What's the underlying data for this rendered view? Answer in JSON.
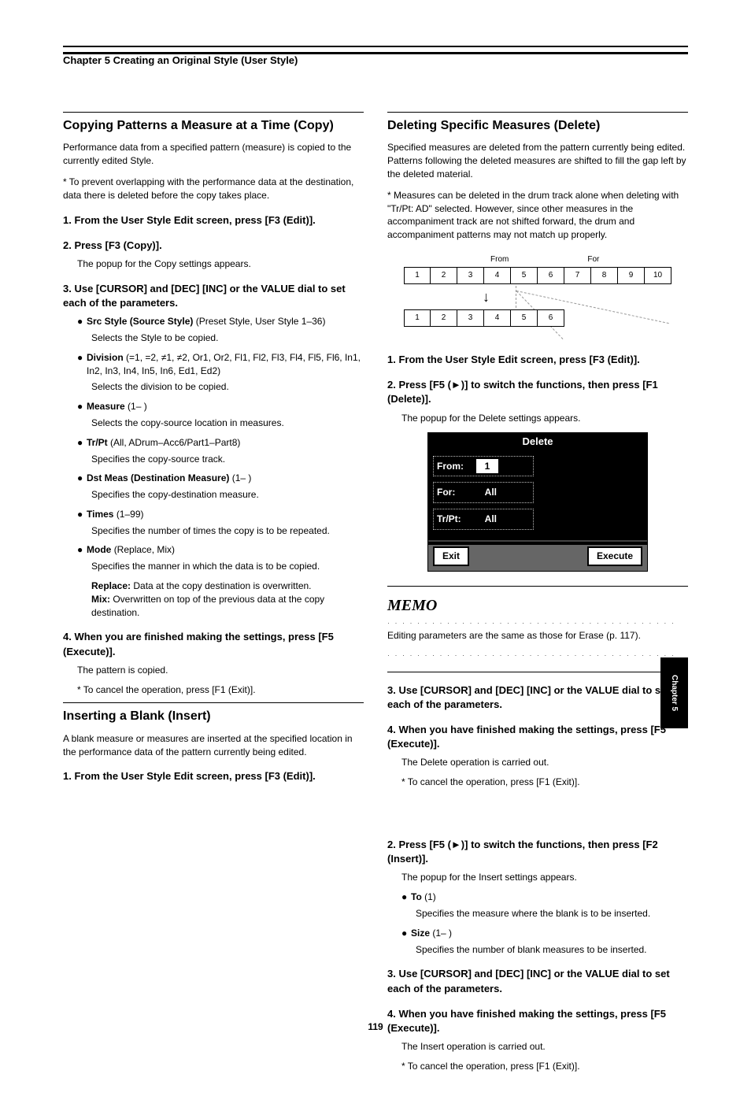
{
  "header": "Chapter 5 Creating an Original Style (User Style)",
  "left": {
    "sec1": {
      "title": "Copying Patterns a Measure at a Time (Copy)",
      "p1": "Performance data from a specified pattern (measure) is copied to the currently edited Style.",
      "p2": "* To prevent overlapping with the performance data at the destination, data there is deleted before the copy takes place.",
      "s1_title": "1. From the User Style Edit screen, press [F3 (Edit)].",
      "s2_title": "2. Press [F3 (Copy)].",
      "s2_note": "The popup for the Copy settings appears.",
      "s3_title": "3. Use [CURSOR] and [DEC] [INC] or the VALUE dial to set each of the parameters.",
      "items": [
        {
          "b": "●",
          "label": "Src Style (Source Style)",
          "text": "(Preset Style, User Style 1–36)",
          "desc": "Selects the Style to be copied."
        },
        {
          "b": "●",
          "label": "Division",
          "text": "(=1, =2, ≠1, ≠2, Or1, Or2, Fl1, Fl2, Fl3, Fl4, Fl5, Fl6, In1, In2, In3, In4, In5, In6, Ed1, Ed2)",
          "desc": "Selects the division to be copied."
        },
        {
          "b": "●",
          "label": "Measure",
          "text": "(1– )",
          "desc": "Selects the copy-source location in measures."
        },
        {
          "b": "●",
          "label": "Tr/Pt",
          "text": "(All, ADrum–Acc6/Part1–Part8)",
          "desc": "Specifies the copy-source track."
        },
        {
          "b": "●",
          "label": "Dst Meas (Destination Measure)",
          "text": "(1– )",
          "desc": "Specifies the copy-destination measure."
        },
        {
          "b": "●",
          "label": "Times",
          "text": "(1–99)",
          "desc": "Specifies the number of times the copy is to be repeated."
        },
        {
          "b": "●",
          "label": "Mode",
          "text": "(Replace, Mix)",
          "desc": "Specifies the manner in which the data is to be copied.",
          "sub": [
            {
              "k": "Replace:",
              "v": "Data at the copy destination is overwritten."
            },
            {
              "k": "Mix:",
              "v": "Overwritten on top of the previous data at the copy destination."
            }
          ]
        }
      ],
      "s4_title": "4. When you are finished making the settings, press [F5 (Execute)].",
      "s4_note1": "The pattern is copied.",
      "s4_note2": "* To cancel the operation, press [F1 (Exit)]."
    },
    "sec2": {
      "title": "Inserting a Blank (Insert)",
      "p1": "A blank measure or measures are inserted at the specified location in the performance data of the pattern currently being edited.",
      "s1_title": "1. From the User Style Edit screen, press [F3 (Edit)]."
    }
  },
  "right": {
    "delete_section": {
      "title": "Deleting Specific Measures (Delete)",
      "p1": "Specified measures are deleted from the pattern currently being edited. Patterns following the deleted measures are shifted to fill the gap left by the deleted material.",
      "p2": "* Measures can be deleted in the drum track alone when deleting with \"Tr/Pt: AD\" selected. However, since other measures in the accompaniment track are not shifted forward, the drum and accompaniment patterns may not match up properly.",
      "diagram": {
        "from_label": "From",
        "for_label": "For",
        "row1": [
          "1",
          "2",
          "3",
          "4",
          "5",
          "6",
          "7",
          "8",
          "9",
          "10"
        ],
        "row2": [
          "1",
          "2",
          "3",
          "4",
          "5",
          "6"
        ]
      },
      "s1": "1. From the User Style Edit screen, press [F3 (Edit)].",
      "s2": "2. Press [F5 (►)] to switch the functions, then press [F1 (Delete)].",
      "s2_note": "The popup for the Delete settings appears.",
      "dialog": {
        "title": "Delete",
        "from_label": "From:",
        "from_val": "1",
        "for_label": "For:",
        "for_val": "All",
        "trpt_label": "Tr/Pt:",
        "trpt_val": "All",
        "exit": "Exit",
        "execute": "Execute"
      },
      "memo_title": "MEMO",
      "memo_text": "Editing parameters are the same as those for Erase (p. 117).",
      "s3": "3. Use [CURSOR] and [DEC] [INC] or the VALUE dial to set each of the parameters.",
      "s4": "4. When you have finished making the settings, press [F5 (Execute)].",
      "s4_note1": "The Delete operation is carried out.",
      "s4_note2": "* To cancel the operation, press [F1 (Exit)]."
    },
    "insert_cont": {
      "s2": "2. Press [F5 (►)] to switch the functions, then press [F2 (Insert)].",
      "s2_note": "The popup for the Insert settings appears.",
      "items": [
        {
          "b": "●",
          "label": "To",
          "text": "(1)",
          "desc": "Specifies the measure where the blank is to be inserted."
        },
        {
          "b": "●",
          "label": "Size",
          "text": "(1– )",
          "desc": "Specifies the number of blank measures to be inserted."
        }
      ],
      "s3": "3. Use [CURSOR] and [DEC] [INC] or the VALUE dial to set each of the parameters.",
      "s4": "4. When you have finished making the settings, press [F5 (Execute)].",
      "s4_note1": "The Insert operation is carried out.",
      "s4_note2": "* To cancel the operation, press [F1 (Exit)]."
    }
  },
  "side_tab": "Chapter 5",
  "page_number": "119"
}
